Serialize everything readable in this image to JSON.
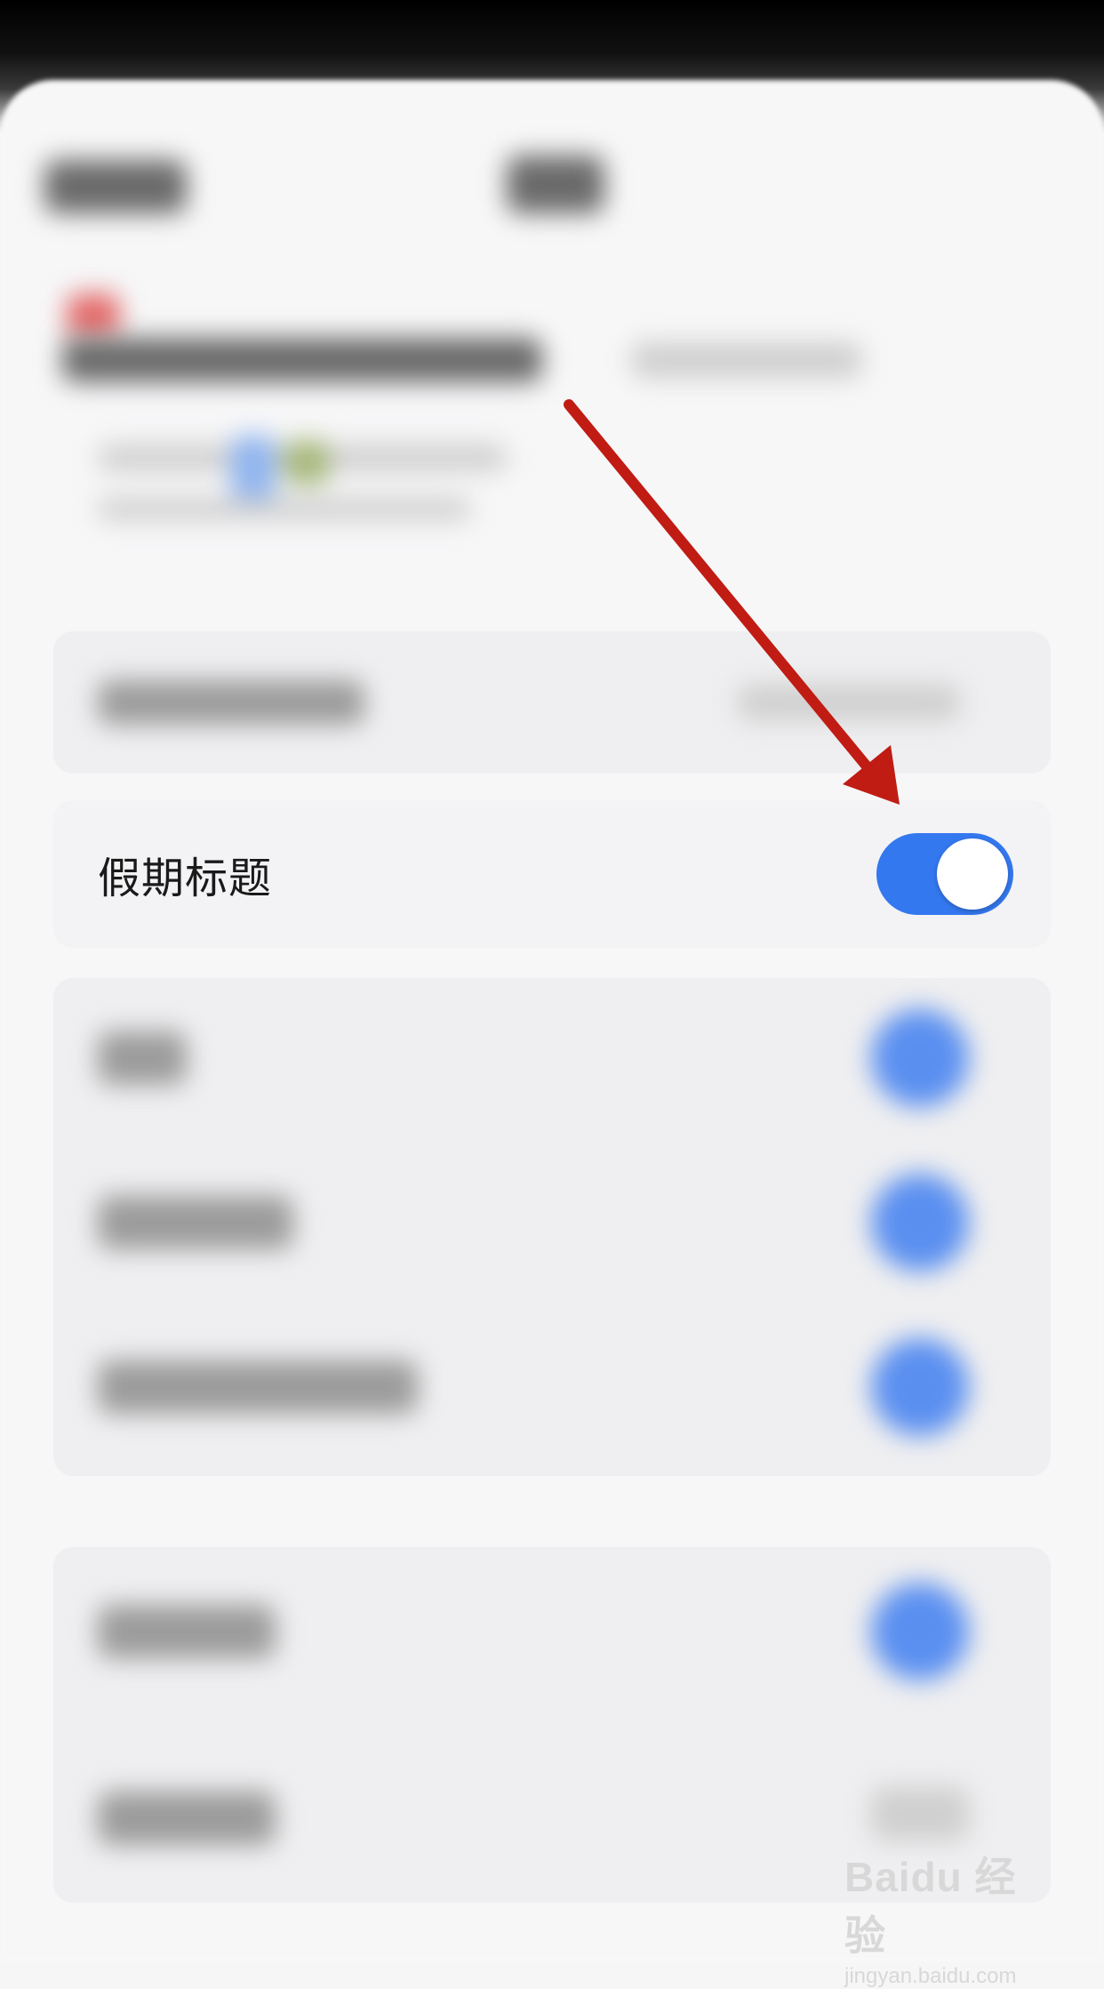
{
  "highlighted_row": {
    "label": "假期标题",
    "toggle_on": true
  },
  "colors": {
    "toggle_on": "#3478f0",
    "arrow": "#c01c14",
    "card_bg": "#f3f3f5"
  },
  "watermark": {
    "logo": "Baidu 经验",
    "url": "jingyan.baidu.com"
  }
}
